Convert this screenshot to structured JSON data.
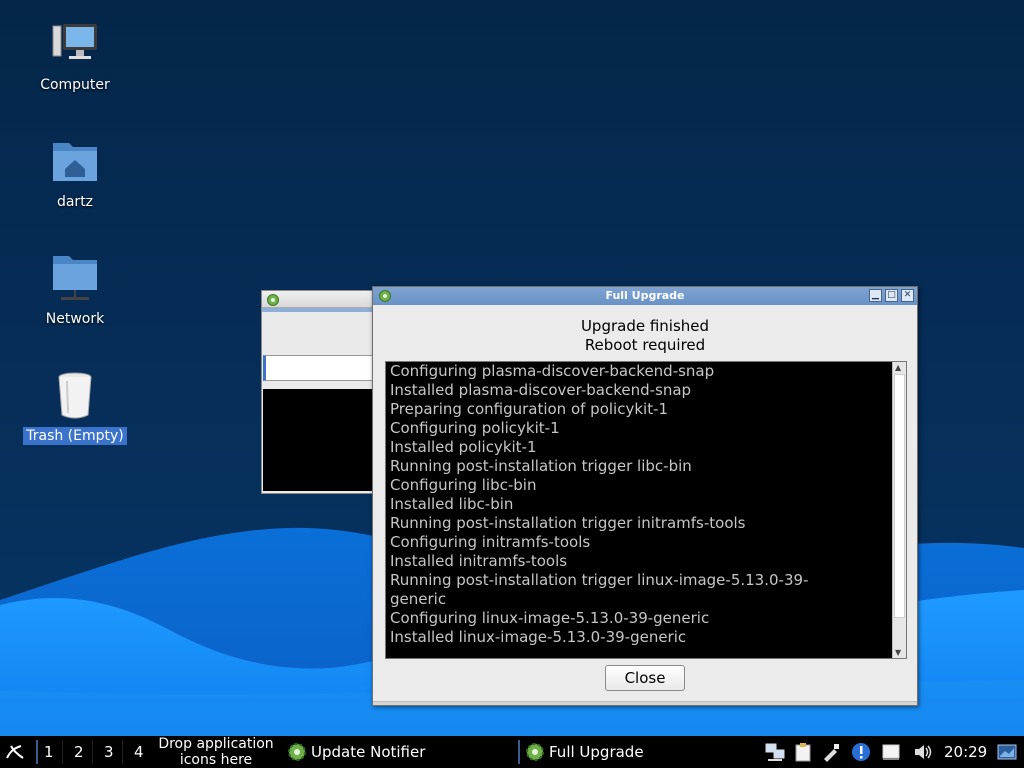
{
  "desktop": {
    "icons": [
      {
        "label": "Computer",
        "icon": "computer-icon"
      },
      {
        "label": "dartz",
        "icon": "home-folder-icon"
      },
      {
        "label": "Network",
        "icon": "network-folder-icon"
      },
      {
        "label": "Trash (Empty)",
        "icon": "trash-icon",
        "selected": true
      }
    ]
  },
  "dialog": {
    "title": "Full Upgrade",
    "heading_line1": "Upgrade finished",
    "heading_line2": "Reboot required",
    "log": [
      "Configuring plasma-discover-backend-snap",
      "Installed plasma-discover-backend-snap",
      "Preparing configuration of policykit-1",
      "Configuring policykit-1",
      "Installed policykit-1",
      "Running post-installation trigger libc-bin",
      "Configuring libc-bin",
      "Installed libc-bin",
      "Running post-installation trigger initramfs-tools",
      "Configuring initramfs-tools",
      "Installed initramfs-tools",
      "Running post-installation trigger linux-image-5.13.0-39-",
      "generic",
      "Configuring linux-image-5.13.0-39-generic",
      "Installed linux-image-5.13.0-39-generic"
    ],
    "close_label": "Close"
  },
  "taskbar": {
    "desktops": [
      "1",
      "2",
      "3",
      "4"
    ],
    "drop_text": "Drop application icons here",
    "tasks": [
      {
        "label": "Update Notifier",
        "icon": "gear-icon"
      },
      {
        "label": "Full Upgrade",
        "icon": "gear-icon"
      }
    ],
    "clock": "20:29"
  },
  "colors": {
    "taskbar_bg": "#000000",
    "titlebar": "#7fa4d2",
    "selection": "#3a73c9",
    "desktop_bg": "#062f57",
    "wave_light": "#1a8ff0"
  }
}
